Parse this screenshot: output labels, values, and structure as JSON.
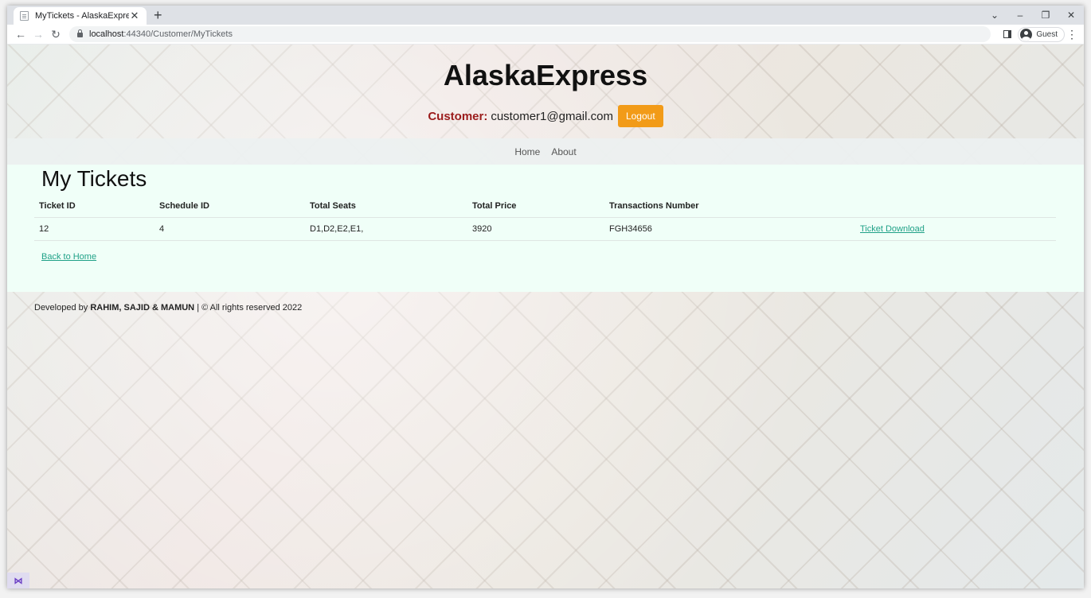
{
  "browser": {
    "tab_title": "MyTickets - AlaskaExpress",
    "tab_close": "✕",
    "new_tab": "+",
    "url_host": "localhost",
    "url_path": ":44340/Customer/MyTickets",
    "profile_label": "Guest",
    "back_icon": "←",
    "forward_icon": "→",
    "reload_icon": "↻",
    "menu_icon": "⋮",
    "win_dropdown": "⌄",
    "win_minimize": "–",
    "win_restore": "❐",
    "win_close": "✕"
  },
  "header": {
    "site_title": "AlaskaExpress",
    "user_label": "Customer:",
    "user_email": "customer1@gmail.com",
    "logout_label": "Logout"
  },
  "nav": {
    "home": "Home",
    "about": "About"
  },
  "main": {
    "title": "My Tickets",
    "columns": [
      "Ticket ID",
      "Schedule ID",
      "Total Seats",
      "Total Price",
      "Transactions Number"
    ],
    "rows": [
      {
        "ticket_id": "12",
        "schedule_id": "4",
        "total_seats": "D1,D2,E2,E1,",
        "total_price": "3920",
        "transaction_number": "FGH34656",
        "action_label": "Ticket Download"
      }
    ],
    "back_label": "Back to Home"
  },
  "footer": {
    "prefix": "Developed by",
    "authors": "RAHIM, SAJID & MAMUN",
    "suffix": "| © All rights reserved 2022"
  },
  "vs_badge": "⋈"
}
